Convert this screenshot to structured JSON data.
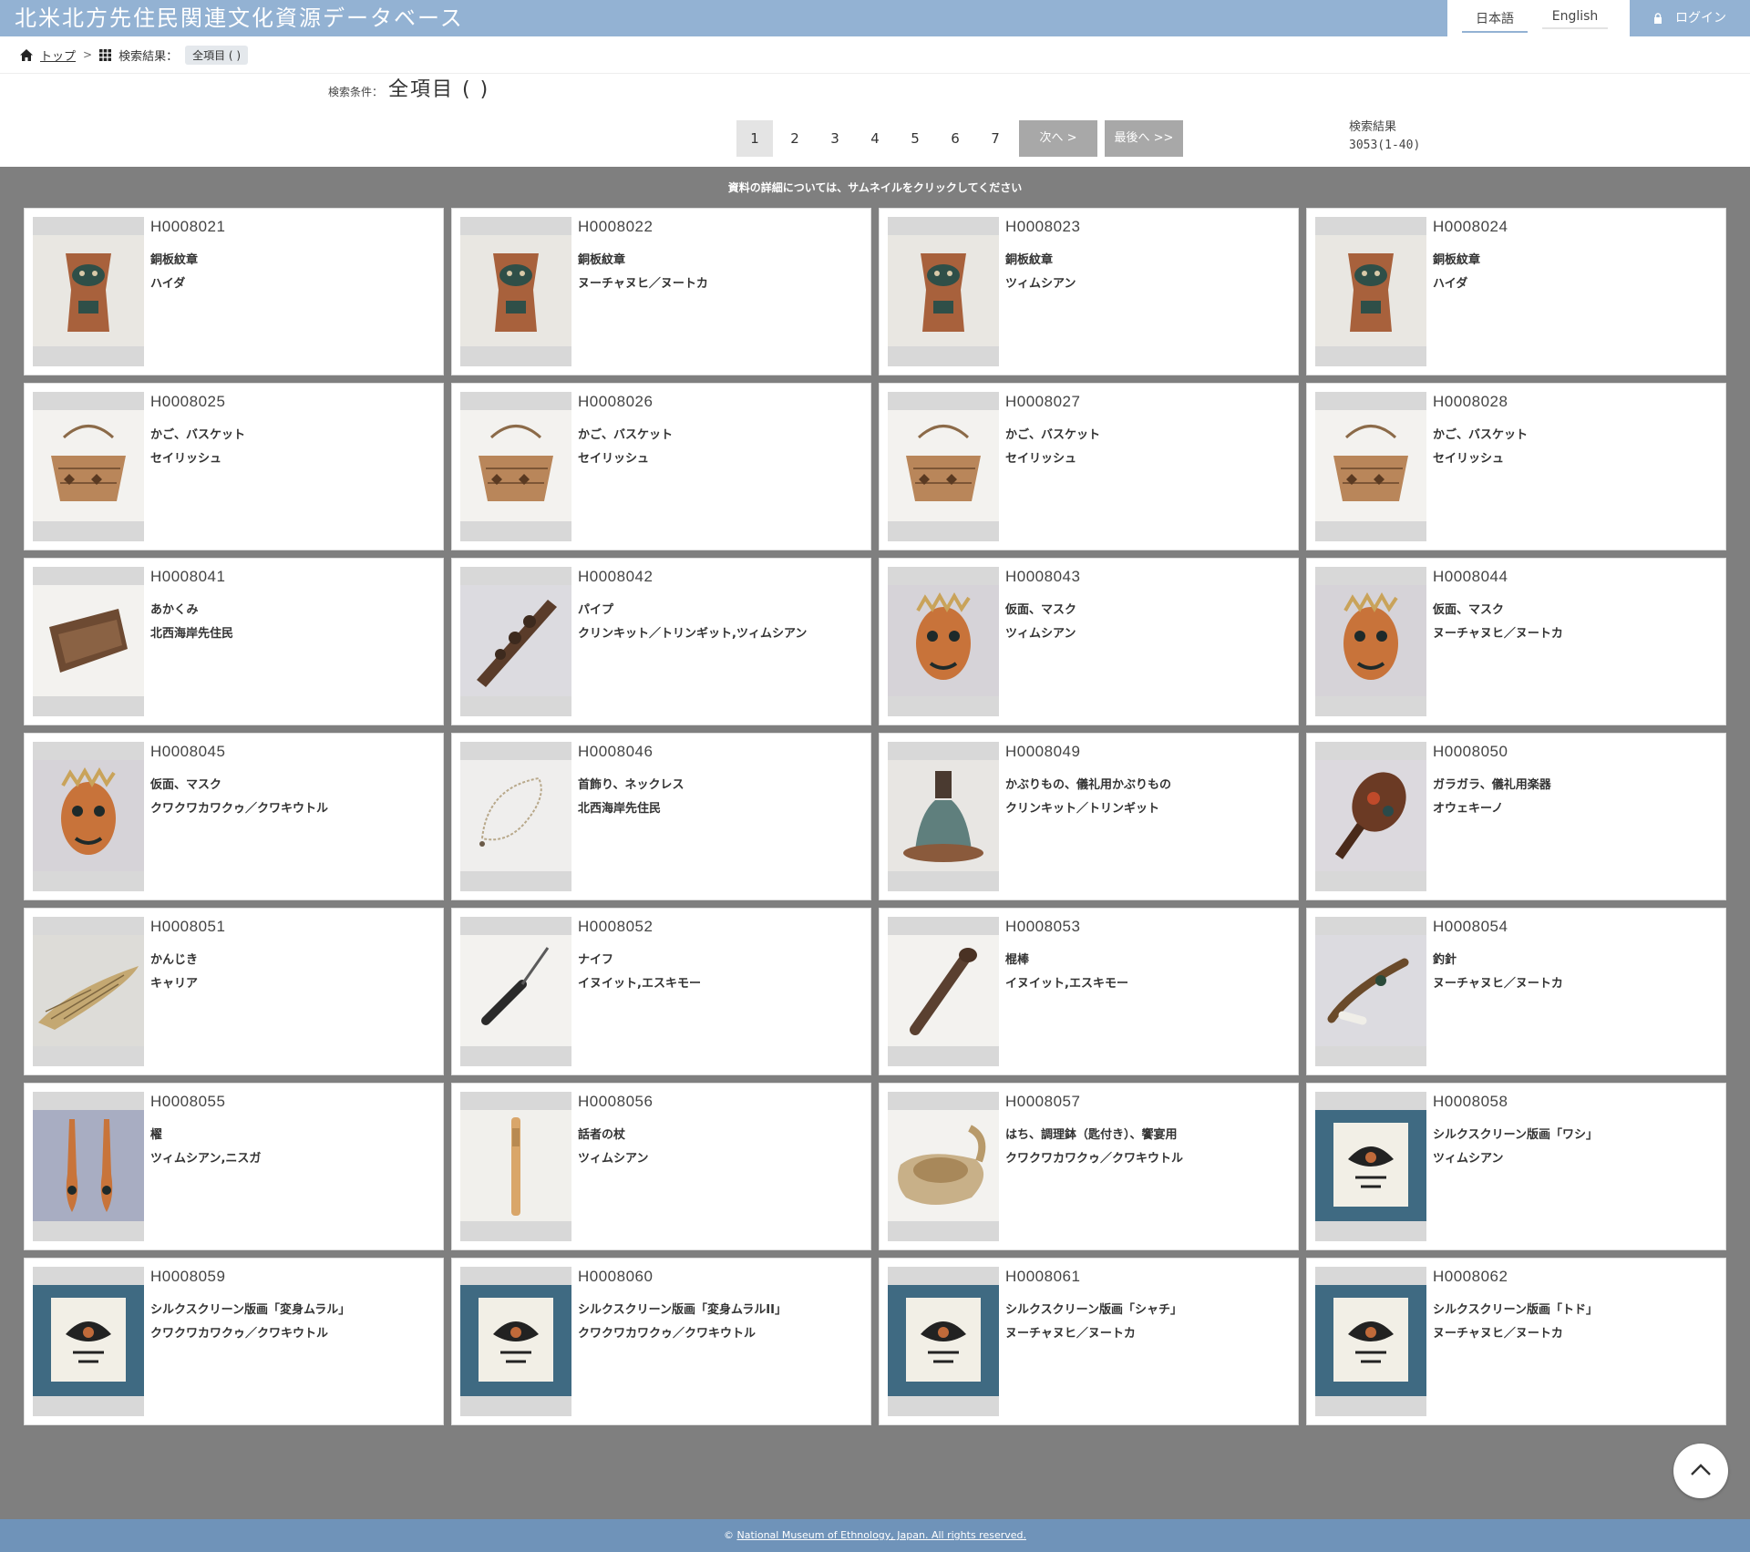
{
  "header": {
    "site_title": "北米北方先住民関連文化資源データベース",
    "lang_ja": "日本語",
    "lang_en": "English",
    "login_label": "ログイン"
  },
  "breadcrumb": {
    "home_label": "トップ",
    "results_label": "検索結果：",
    "current": "全項目 ( )"
  },
  "search": {
    "condition_label": "検索条件：",
    "condition_value": "全項目 ( )"
  },
  "pagination": {
    "pages": [
      "1",
      "2",
      "3",
      "4",
      "5",
      "6",
      "7"
    ],
    "current_page": "1",
    "next_label": "次へ >",
    "last_label": "最後へ >>",
    "result_label": "検索結果",
    "result_count": "3053(1-40)"
  },
  "notice": "資料の詳細については、サムネイルをクリックしてください",
  "items": [
    {
      "id": "H0008021",
      "name": "銅板紋章",
      "group": "ハイダ",
      "icon": "copper-shield-icon"
    },
    {
      "id": "H0008022",
      "name": "銅板紋章",
      "group": "ヌーチャヌヒ／ヌートカ",
      "icon": "copper-shield-icon"
    },
    {
      "id": "H0008023",
      "name": "銅板紋章",
      "group": "ツィムシアン",
      "icon": "copper-shield-icon"
    },
    {
      "id": "H0008024",
      "name": "銅板紋章",
      "group": "ハイダ",
      "icon": "copper-shield-icon"
    },
    {
      "id": "H0008025",
      "name": "かご、バスケット",
      "group": "セイリッシュ",
      "icon": "basket-icon"
    },
    {
      "id": "H0008026",
      "name": "かご、バスケット",
      "group": "セイリッシュ",
      "icon": "basket-icon"
    },
    {
      "id": "H0008027",
      "name": "かご、バスケット",
      "group": "セイリッシュ",
      "icon": "basket-icon"
    },
    {
      "id": "H0008028",
      "name": "かご、バスケット",
      "group": "セイリッシュ",
      "icon": "basket-icon"
    },
    {
      "id": "H0008041",
      "name": "あかくみ",
      "group": "北西海岸先住民",
      "icon": "bailer-icon"
    },
    {
      "id": "H0008042",
      "name": "パイプ",
      "group": "クリンキット／トリンギット,ツィムシアン",
      "icon": "pipe-icon"
    },
    {
      "id": "H0008043",
      "name": "仮面、マスク",
      "group": "ツィムシアン",
      "icon": "mask-icon"
    },
    {
      "id": "H0008044",
      "name": "仮面、マスク",
      "group": "ヌーチャヌヒ／ヌートカ",
      "icon": "mask-icon"
    },
    {
      "id": "H0008045",
      "name": "仮面、マスク",
      "group": "クワクワカワクゥ／クワキウトル",
      "icon": "mask-icon"
    },
    {
      "id": "H0008046",
      "name": "首飾り、ネックレス",
      "group": "北西海岸先住民",
      "icon": "necklace-icon"
    },
    {
      "id": "H0008049",
      "name": "かぶりもの、儀礼用かぶりもの",
      "group": "クリンキット／トリンギット",
      "icon": "hat-icon"
    },
    {
      "id": "H0008050",
      "name": "ガラガラ、儀礼用楽器",
      "group": "オウェキーノ",
      "icon": "rattle-icon"
    },
    {
      "id": "H0008051",
      "name": "かんじき",
      "group": "キャリア",
      "icon": "snowshoe-icon"
    },
    {
      "id": "H0008052",
      "name": "ナイフ",
      "group": "イヌイット,エスキモー",
      "icon": "knife-icon"
    },
    {
      "id": "H0008053",
      "name": "棍棒",
      "group": "イヌイット,エスキモー",
      "icon": "club-icon"
    },
    {
      "id": "H0008054",
      "name": "釣針",
      "group": "ヌーチャヌヒ／ヌートカ",
      "icon": "fishhook-icon"
    },
    {
      "id": "H0008055",
      "name": "櫂",
      "group": "ツィムシアン,ニスガ",
      "icon": "paddle-icon"
    },
    {
      "id": "H0008056",
      "name": "話者の杖",
      "group": "ツィムシアン",
      "icon": "staff-icon"
    },
    {
      "id": "H0008057",
      "name": "はち、調理鉢（匙付き）、饗宴用",
      "group": "クワクワカワクゥ／クワキウトル",
      "icon": "bowl-icon"
    },
    {
      "id": "H0008058",
      "name": "シルクスクリーン版画「ワシ」",
      "group": "ツィムシアン",
      "icon": "print-icon"
    },
    {
      "id": "H0008059",
      "name": "シルクスクリーン版画「変身ムラル」",
      "group": "クワクワカワクゥ／クワキウトル",
      "icon": "print-icon"
    },
    {
      "id": "H0008060",
      "name": "シルクスクリーン版画「変身ムラルII」",
      "group": "クワクワカワクゥ／クワキウトル",
      "icon": "print-icon"
    },
    {
      "id": "H0008061",
      "name": "シルクスクリーン版画「シャチ」",
      "group": "ヌーチャヌヒ／ヌートカ",
      "icon": "print-icon"
    },
    {
      "id": "H0008062",
      "name": "シルクスクリーン版画「トド」",
      "group": "ヌーチャヌヒ／ヌートカ",
      "icon": "print-icon"
    }
  ],
  "footer": {
    "copyright": "©",
    "link_text": "National Museum of Ethnology, Japan. All rights reserved."
  },
  "colors": {
    "header_bg": "#93b2d3",
    "main_bg": "#7f7f7f",
    "footer_bg": "#6f93b9",
    "nav_button": "#a8a8a8"
  }
}
